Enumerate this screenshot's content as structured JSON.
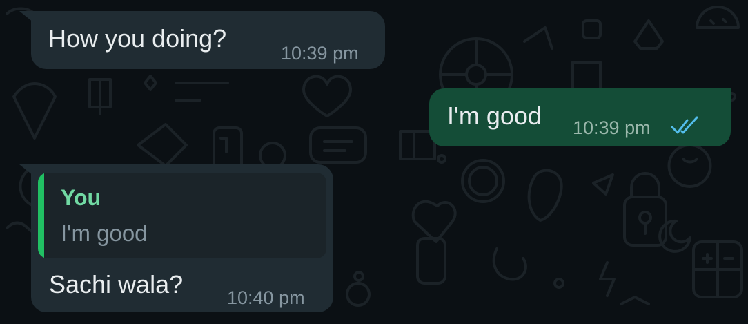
{
  "messages": [
    {
      "direction": "incoming",
      "text": "How you doing?",
      "time": "10:39 pm"
    },
    {
      "direction": "outgoing",
      "text": "I'm good",
      "time": "10:39 pm",
      "status_icon": "double-check-icon",
      "status_color": "#53bdeb"
    },
    {
      "direction": "incoming",
      "text": "Sachi wala?",
      "time": "10:40 pm",
      "quoted": {
        "author": "You",
        "text": "I'm good"
      }
    }
  ],
  "colors": {
    "background": "#0b1014",
    "incoming_bubble": "#202c33",
    "outgoing_bubble": "#144d37",
    "quote_accent": "#21c063"
  }
}
